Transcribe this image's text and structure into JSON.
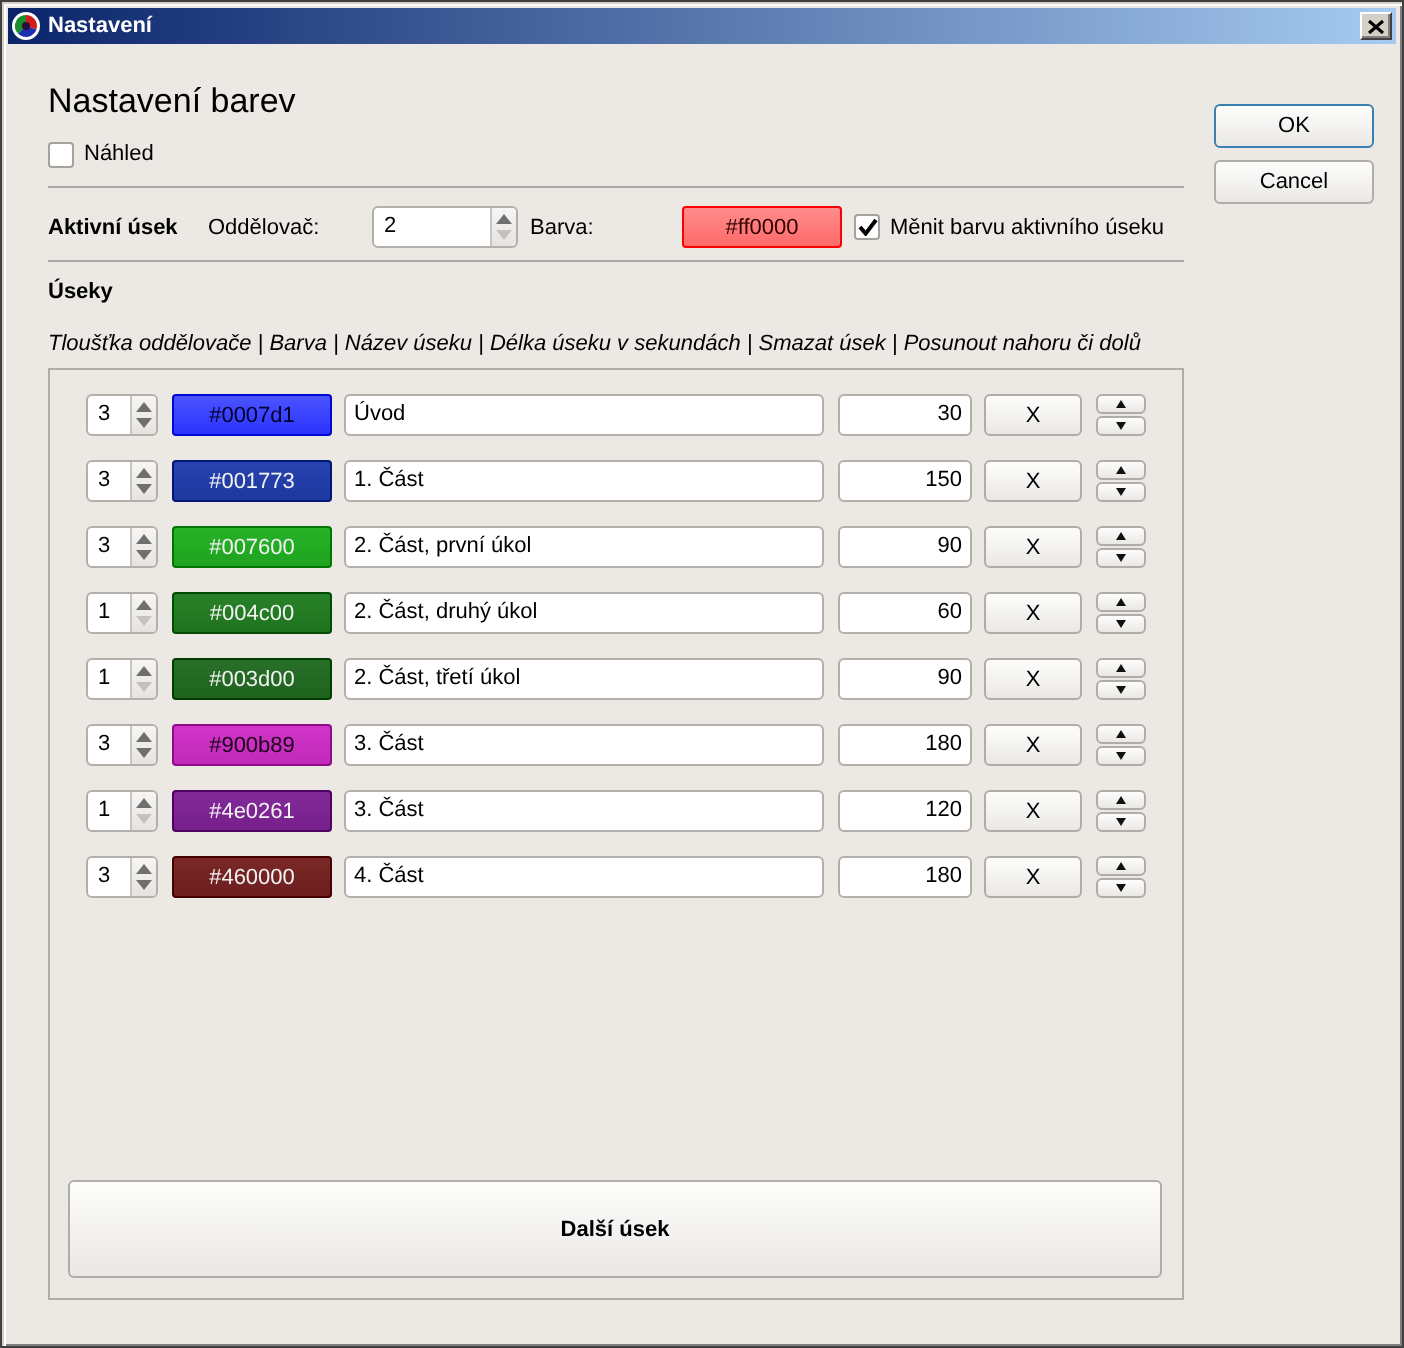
{
  "window": {
    "title": "Nastavení"
  },
  "heading": "Nastavení barev",
  "preview": {
    "label": "Náhled",
    "checked": false
  },
  "buttons": [
    {
      "label": "OK",
      "default": true
    },
    {
      "label": "Cancel",
      "default": false
    }
  ],
  "active_section": {
    "label": "Aktivní úsek",
    "separator_label": "Oddělovač:",
    "separator": {
      "value": "2",
      "down_disabled": true
    },
    "color_label": "Barva:",
    "color_button": {
      "text": "#ff0000",
      "color": "#ff0000"
    },
    "change_color": {
      "label": "Měnit barvu aktivního úseku",
      "checked": true
    }
  },
  "sections": {
    "title": "Úseky",
    "columns_hint": "Tloušťka oddělovače | Barva | Název úseku | Délka úseku v sekundách | Smazat úsek | Posunout nahoru či dolů",
    "rows": [
      {
        "separator": "3",
        "down_disabled": false,
        "color_text": "#0007d1",
        "color": "#0007d1",
        "name": "Úvod",
        "length": "30",
        "delete": "X"
      },
      {
        "separator": "3",
        "down_disabled": false,
        "color_text": "#001773",
        "color": "#001773",
        "name": "1. Část",
        "length": "150",
        "delete": "X"
      },
      {
        "separator": "3",
        "down_disabled": false,
        "color_text": "#007600",
        "color": "#007600",
        "name": "2. Část, první úkol",
        "length": "90",
        "delete": "X"
      },
      {
        "separator": "1",
        "down_disabled": true,
        "color_text": "#004c00",
        "color": "#004c00",
        "name": "2. Část, druhý úkol",
        "length": "60",
        "delete": "X"
      },
      {
        "separator": "1",
        "down_disabled": true,
        "color_text": "#003d00",
        "color": "#003d00",
        "name": "2. Část, třetí úkol",
        "length": "90",
        "delete": "X"
      },
      {
        "separator": "3",
        "down_disabled": false,
        "color_text": "#900b89",
        "color": "#900b89",
        "name": "3. Část",
        "length": "180",
        "delete": "X"
      },
      {
        "separator": "1",
        "down_disabled": true,
        "color_text": "#4e0261",
        "color": "#4e0261",
        "name": "3. Část",
        "length": "120",
        "delete": "X"
      },
      {
        "separator": "3",
        "down_disabled": false,
        "color_text": "#460000",
        "color": "#460000",
        "name": "4. Část",
        "length": "180",
        "delete": "X"
      }
    ],
    "add_button": "Další úsek"
  }
}
